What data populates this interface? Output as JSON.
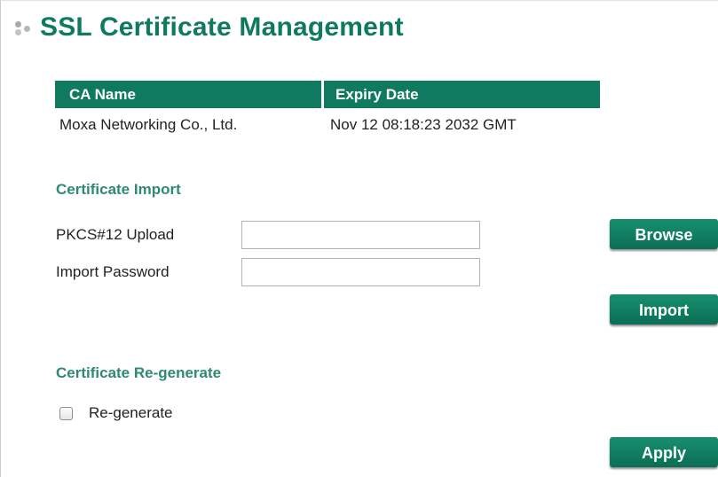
{
  "header": {
    "title": "SSL Certificate Management",
    "icon": "dots-icon"
  },
  "ca_table": {
    "columns": [
      "CA Name",
      "Expiry Date"
    ],
    "rows": [
      [
        "Moxa Networking Co., Ltd.",
        "Nov 12 08:18:23 2032 GMT"
      ]
    ]
  },
  "certificate_import": {
    "heading": "Certificate Import",
    "pkcs_label": "PKCS#12 Upload",
    "pkcs_value": "",
    "password_label": "Import Password",
    "password_value": "",
    "browse_label": "Browse",
    "import_label": "Import"
  },
  "certificate_regenerate": {
    "heading": "Certificate Re-generate",
    "checkbox_label": "Re-generate",
    "checked": false,
    "apply_label": "Apply"
  },
  "colors": {
    "accent": "#0f7a5f",
    "heading": "#2e8a72",
    "text": "#222222"
  }
}
